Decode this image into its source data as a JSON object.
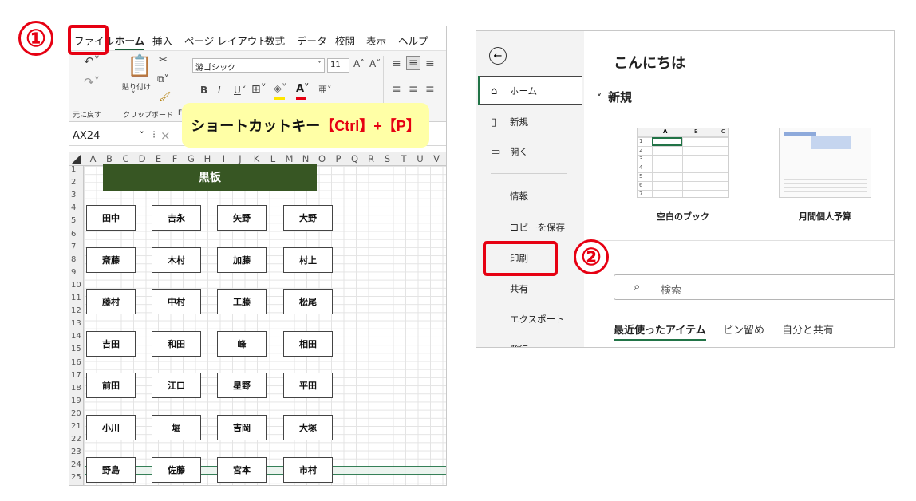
{
  "steps": {
    "one": "①",
    "two": "②"
  },
  "excel": {
    "menu": [
      "ファイル",
      "ホーム",
      "挿入",
      "ページ レイアウト",
      "数式",
      "データ",
      "校閲",
      "表示",
      "ヘルプ"
    ],
    "ribbon": {
      "undo_label": "元に戻す",
      "paste_label": "貼り付け",
      "clipboard_label": "クリップボード",
      "clipboard_trailing": "F",
      "font_name": "游ゴシック",
      "font_size": "11",
      "bold": "B",
      "italic": "I",
      "underline": "U",
      "grow_font": "A˄",
      "shrink_font": "A˅"
    },
    "name_box": "AX24",
    "shortcut": {
      "text": "ショートカットキー",
      "keys": "【Ctrl】+【P】"
    },
    "columns": [
      "A",
      "B",
      "C",
      "D",
      "E",
      "F",
      "G",
      "H",
      "I",
      "J",
      "K",
      "L",
      "M",
      "N",
      "O",
      "P",
      "Q",
      "R",
      "S",
      "T",
      "U",
      "V"
    ],
    "rows": [
      "1",
      "2",
      "3",
      "4",
      "5",
      "6",
      "7",
      "8",
      "9",
      "10",
      "11",
      "12",
      "13",
      "14",
      "15",
      "16",
      "17",
      "18",
      "19",
      "20",
      "21",
      "22",
      "23",
      "24",
      "25"
    ],
    "blackboard": "黒板",
    "seats": [
      [
        "田中",
        "吉永",
        "矢野",
        "大野"
      ],
      [
        "斎藤",
        "木村",
        "加藤",
        "村上"
      ],
      [
        "藤村",
        "中村",
        "工藤",
        "松尾"
      ],
      [
        "吉田",
        "和田",
        "峰",
        "相田"
      ],
      [
        "前田",
        "江口",
        "星野",
        "平田"
      ],
      [
        "小川",
        "堀",
        "吉岡",
        "大塚"
      ],
      [
        "野島",
        "佐藤",
        "宮本",
        "市村"
      ]
    ]
  },
  "backstage": {
    "back_icon": "←",
    "nav": [
      {
        "icon": "⌂",
        "label": "ホーム"
      },
      {
        "icon": "▯",
        "label": "新規"
      },
      {
        "icon": "▭",
        "label": "開く"
      },
      {
        "icon": "",
        "label": "情報"
      },
      {
        "icon": "",
        "label": "コピーを保存"
      },
      {
        "icon": "",
        "label": "印刷"
      },
      {
        "icon": "",
        "label": "共有"
      },
      {
        "icon": "",
        "label": "エクスポート"
      },
      {
        "icon": "",
        "label": "発行"
      }
    ],
    "greeting": "こんにちは",
    "new_section": "新規",
    "templates": [
      {
        "label": "空白のブック"
      },
      {
        "label": "月間個人予算"
      }
    ],
    "template_cols": [
      "A",
      "B",
      "C"
    ],
    "template_rows": [
      "1",
      "2",
      "3",
      "4",
      "5",
      "6",
      "7"
    ],
    "search_placeholder": "検索",
    "tabs": [
      "最近使ったアイテム",
      "ピン留め",
      "自分と共有"
    ]
  }
}
